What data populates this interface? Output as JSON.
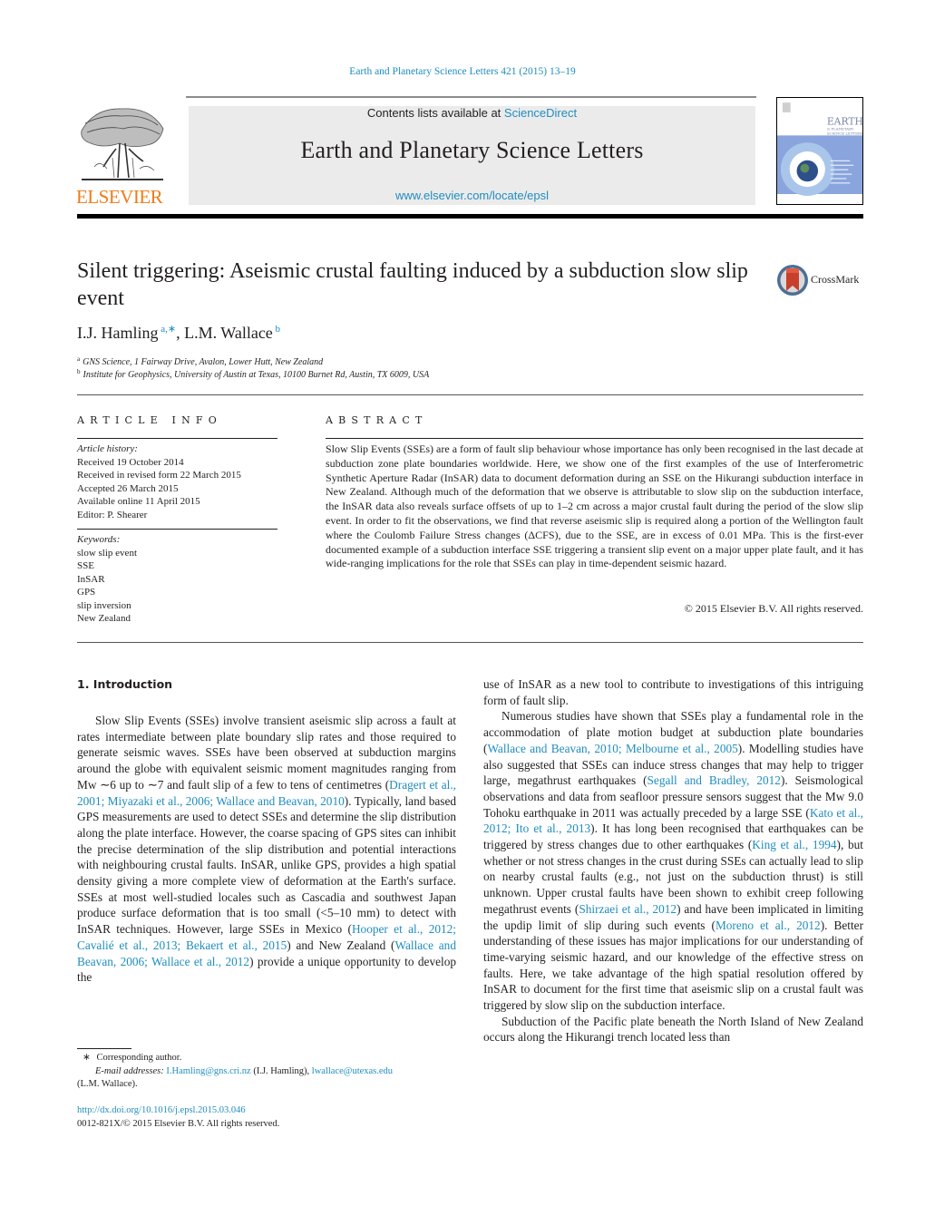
{
  "running_header": "Earth and Planetary Science Letters 421 (2015) 13–19",
  "masthead": {
    "publisher_logo_text": "ELSEVIER",
    "contents_prefix": "Contents lists available at ",
    "contents_link": "ScienceDirect",
    "journal_title": "Earth and Planetary Science Letters",
    "journal_url": "www.elsevier.com/locate/epsl",
    "cover_title_lines": [
      "EARTH",
      "& PLANETARY",
      "SCIENCE LETTERS"
    ]
  },
  "article": {
    "title": "Silent triggering: Aseismic crustal faulting induced by a subduction slow slip event",
    "crossmark_label": "CrossMark",
    "authors": [
      {
        "name": "I.J. Hamling",
        "sup": "a,∗"
      },
      {
        "name": "L.M. Wallace",
        "sup": "b"
      }
    ],
    "author_separator": ", ",
    "affiliations": [
      {
        "key": "a",
        "text": "GNS Science, 1 Fairway Drive, Avalon, Lower Hutt, New Zealand"
      },
      {
        "key": "b",
        "text": "Institute for Geophysics, University of Austin at Texas, 10100 Burnet Rd, Austin, TX 6009, USA"
      }
    ]
  },
  "article_info": {
    "heading": "ARTICLE INFO",
    "history_label": "Article history:",
    "history": [
      "Received 19 October 2014",
      "Received in revised form 22 March 2015",
      "Accepted 26 March 2015",
      "Available online 11 April 2015",
      "Editor: P. Shearer"
    ],
    "keywords_label": "Keywords:",
    "keywords": [
      "slow slip event",
      "SSE",
      "InSAR",
      "GPS",
      "slip inversion",
      "New Zealand"
    ]
  },
  "abstract": {
    "heading": "ABSTRACT",
    "text": "Slow Slip Events (SSEs) are a form of fault slip behaviour whose importance has only been recognised in the last decade at subduction zone plate boundaries worldwide. Here, we show one of the first examples of the use of Interferometric Synthetic Aperture Radar (InSAR) data to document deformation during an SSE on the Hikurangi subduction interface in New Zealand. Although much of the deformation that we observe is attributable to slow slip on the subduction interface, the InSAR data also reveals surface offsets of up to 1–2 cm across a major crustal fault during the period of the slow slip event. In order to fit the observations, we find that reverse aseismic slip is required along a portion of the Wellington fault where the Coulomb Failure Stress changes (ΔCFS), due to the SSE, are in excess of 0.01 MPa. This is the first-ever documented example of a subduction interface SSE triggering a transient slip event on a major upper plate fault, and it has wide-ranging implications for the role that SSEs can play in time-dependent seismic hazard.",
    "copyright": "© 2015 Elsevier B.V. All rights reserved."
  },
  "body": {
    "section_heading": "1.  Introduction",
    "left_paragraph": [
      {
        "t": "Slow Slip Events (SSEs) involve transient aseismic slip across a fault at rates intermediate between plate boundary slip rates and those required to generate seismic waves. SSEs have been ob­served at subduction margins around the globe with equivalent seismic moment magnitudes ranging from Mw ∼6 up to ∼7 and fault slip of a few to tens of centimetres ("
      },
      {
        "t": "Dragert et al., 2001; Miyazaki et al., 2006; Wallace and Beavan, 2010",
        "link": true
      },
      {
        "t": "). Typically, land based GPS measurements are used to detect SSEs and deter­mine the slip distribution along the plate interface. However, the coarse spacing of GPS sites can inhibit the precise determina­tion of the slip distribution and potential interactions with neigh­bouring crustal faults. InSAR, unlike GPS, provides a high spa­tial density giving a more complete view of deformation at the Earth's surface. SSEs at most well-studied locales such as Casca­dia and southwest Japan produce surface deformation that is too small (<5–10 mm) to detect with InSAR techniques. However, large SSEs in Mexico ("
      },
      {
        "t": "Hooper et al., 2012; Cavalié et al., 2013; Bekaert et al., 2015",
        "link": true
      },
      {
        "t": ") and New Zealand ("
      },
      {
        "t": "Wallace and Beavan, 2006; Wallace et al., 2012",
        "link": true
      },
      {
        "t": ") provide a unique opportunity to develop the"
      }
    ],
    "right_paragraph_1": [
      {
        "t": "use of InSAR as a new tool to contribute to investigations of this intriguing form of fault slip."
      }
    ],
    "right_paragraph_2": [
      {
        "t": "Numerous studies have shown that SSEs play a fundamental role in the accommodation of plate motion budget at subduc­tion plate boundaries ("
      },
      {
        "t": "Wallace and Beavan, 2010; Melbourne et al., 2005",
        "link": true
      },
      {
        "t": "). Modelling studies have also suggested that SSEs can induce stress changes that may help to trigger large, megathrust earth­quakes ("
      },
      {
        "t": "Segall and Bradley, 2012",
        "link": true
      },
      {
        "t": "). Seismological observations and data from seafloor pressure sensors suggest that the Mw 9.0 To­hoku earthquake in 2011 was actually preceded by a large SSE ("
      },
      {
        "t": "Kato et al., 2012; Ito et al., 2013",
        "link": true
      },
      {
        "t": "). It has long been recognised that earthquakes can be triggered by stress changes due to other earthquakes ("
      },
      {
        "t": "King et al., 1994",
        "link": true
      },
      {
        "t": "), but whether or not stress changes in the crust during SSEs can actually lead to slip on nearby crustal faults (e.g., not just on the subduction thrust) is still unknown. Upper crustal faults have been shown to exhibit creep following megathrust events ("
      },
      {
        "t": "Shirzaei et al., 2012",
        "link": true
      },
      {
        "t": ") and have been implicated in limiting the updip limit of slip during such events ("
      },
      {
        "t": "Moreno et al., 2012",
        "link": true
      },
      {
        "t": "). Better understanding of these issues has major im­plications for our understanding of time-varying seismic hazard, and our knowledge of the effective stress on faults. Here, we take advantage of the high spatial resolution offered by InSAR to doc­ument for the first time that aseismic slip on a crustal fault was triggered by slow slip on the subduction interface."
      }
    ],
    "right_paragraph_3": [
      {
        "t": "Subduction of the Pacific plate beneath the North Island of New Zealand occurs along the Hikurangi trench located less than"
      }
    ]
  },
  "footnotes": {
    "star": "∗",
    "corresponding": "Corresponding author.",
    "email_label": "E-mail addresses:",
    "email_1": "I.Hamling@gns.cri.nz",
    "email_1_owner": " (I.J. Hamling), ",
    "email_2": "lwallace@utexas.edu",
    "email_2_owner": "(L.M. Wallace)."
  },
  "footer": {
    "doi": "http://dx.doi.org/10.1016/j.epsl.2015.03.046",
    "issn_copyright": "0012-821X/© 2015 Elsevier B.V. All rights reserved."
  },
  "colors": {
    "link": "#1f8dbf",
    "elsevier_orange": "#f07c18",
    "masthead_gray": "#ebebeb",
    "text": "#231f20"
  }
}
